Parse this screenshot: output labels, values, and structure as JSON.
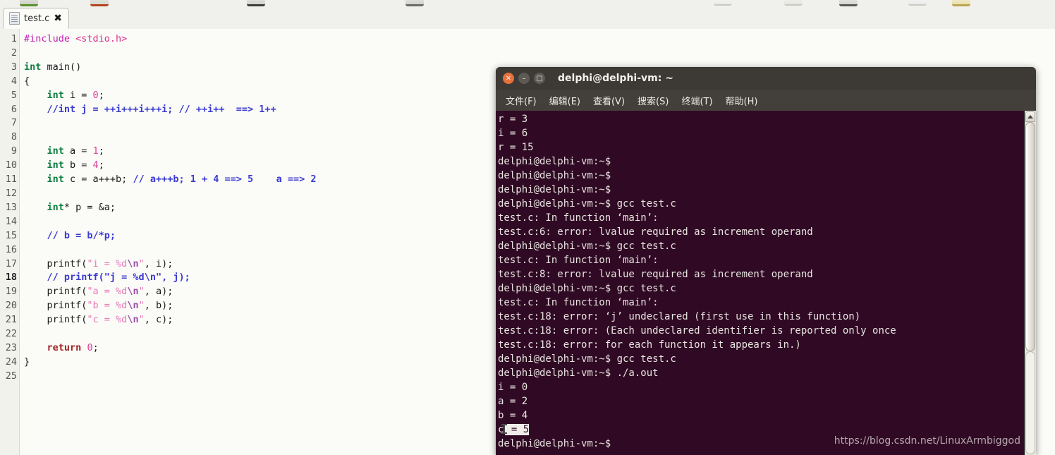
{
  "editor": {
    "tab": {
      "label": "test.c",
      "close_label": "✖",
      "icon": "document-icon"
    },
    "lines": [
      {
        "n": "1",
        "tokens": [
          {
            "t": "#include ",
            "c": "pp"
          },
          {
            "t": "<stdio.h>",
            "c": "hd"
          }
        ]
      },
      {
        "n": "2",
        "tokens": []
      },
      {
        "n": "3",
        "tokens": [
          {
            "t": "int",
            "c": "k"
          },
          {
            "t": " main()",
            "c": ""
          }
        ]
      },
      {
        "n": "4",
        "tokens": [
          {
            "t": "{",
            "c": ""
          }
        ]
      },
      {
        "n": "5",
        "tokens": [
          {
            "t": "    ",
            "c": ""
          },
          {
            "t": "int",
            "c": "k"
          },
          {
            "t": " i = ",
            "c": ""
          },
          {
            "t": "0",
            "c": "nm"
          },
          {
            "t": ";",
            "c": ""
          }
        ]
      },
      {
        "n": "6",
        "tokens": [
          {
            "t": "    ",
            "c": ""
          },
          {
            "t": "//int j = ++i+++i+++i; // ++i++  ==> 1++",
            "c": "cm"
          }
        ]
      },
      {
        "n": "7",
        "tokens": []
      },
      {
        "n": "8",
        "tokens": []
      },
      {
        "n": "9",
        "tokens": [
          {
            "t": "    ",
            "c": ""
          },
          {
            "t": "int",
            "c": "k"
          },
          {
            "t": " a = ",
            "c": ""
          },
          {
            "t": "1",
            "c": "nm"
          },
          {
            "t": ";",
            "c": ""
          }
        ]
      },
      {
        "n": "10",
        "tokens": [
          {
            "t": "    ",
            "c": ""
          },
          {
            "t": "int",
            "c": "k"
          },
          {
            "t": " b = ",
            "c": ""
          },
          {
            "t": "4",
            "c": "nm"
          },
          {
            "t": ";",
            "c": ""
          }
        ]
      },
      {
        "n": "11",
        "tokens": [
          {
            "t": "    ",
            "c": ""
          },
          {
            "t": "int",
            "c": "k"
          },
          {
            "t": " c = a+++b; ",
            "c": ""
          },
          {
            "t": "// a+++b; 1 + 4 ==> 5    a ==> 2",
            "c": "cm"
          }
        ]
      },
      {
        "n": "12",
        "tokens": []
      },
      {
        "n": "13",
        "tokens": [
          {
            "t": "    ",
            "c": ""
          },
          {
            "t": "int",
            "c": "k"
          },
          {
            "t": "* p = &a;",
            "c": ""
          }
        ]
      },
      {
        "n": "14",
        "tokens": []
      },
      {
        "n": "15",
        "tokens": [
          {
            "t": "    ",
            "c": ""
          },
          {
            "t": "// b = b/*p;",
            "c": "cm"
          }
        ]
      },
      {
        "n": "16",
        "tokens": []
      },
      {
        "n": "17",
        "tokens": [
          {
            "t": "    printf(",
            "c": ""
          },
          {
            "t": "\"i = %d",
            "c": "st"
          },
          {
            "t": "\\n",
            "c": "es"
          },
          {
            "t": "\"",
            "c": "st"
          },
          {
            "t": ", i);",
            "c": ""
          }
        ]
      },
      {
        "n": "18",
        "tokens": [
          {
            "t": "    ",
            "c": ""
          },
          {
            "t": "// printf(\"j = %d\\n\", j);",
            "c": "cm"
          }
        ],
        "current": true
      },
      {
        "n": "19",
        "tokens": [
          {
            "t": "    printf(",
            "c": ""
          },
          {
            "t": "\"a = %d",
            "c": "st"
          },
          {
            "t": "\\n",
            "c": "es"
          },
          {
            "t": "\"",
            "c": "st"
          },
          {
            "t": ", a);",
            "c": ""
          }
        ]
      },
      {
        "n": "20",
        "tokens": [
          {
            "t": "    printf(",
            "c": ""
          },
          {
            "t": "\"b = %d",
            "c": "st"
          },
          {
            "t": "\\n",
            "c": "es"
          },
          {
            "t": "\"",
            "c": "st"
          },
          {
            "t": ", b);",
            "c": ""
          }
        ]
      },
      {
        "n": "21",
        "tokens": [
          {
            "t": "    printf(",
            "c": ""
          },
          {
            "t": "\"c = %d",
            "c": "st"
          },
          {
            "t": "\\n",
            "c": "es"
          },
          {
            "t": "\"",
            "c": "st"
          },
          {
            "t": ", c);",
            "c": ""
          }
        ]
      },
      {
        "n": "22",
        "tokens": []
      },
      {
        "n": "23",
        "tokens": [
          {
            "t": "    ",
            "c": ""
          },
          {
            "t": "return",
            "c": "rt"
          },
          {
            "t": " ",
            "c": ""
          },
          {
            "t": "0",
            "c": "nm"
          },
          {
            "t": ";",
            "c": ""
          }
        ]
      },
      {
        "n": "24",
        "tokens": [
          {
            "t": "}",
            "c": ""
          }
        ]
      },
      {
        "n": "25",
        "tokens": []
      }
    ]
  },
  "terminal": {
    "title": "delphi@delphi-vm: ~",
    "window_buttons": {
      "close": "✕",
      "minimize": "–",
      "maximize": "▢"
    },
    "menu": [
      {
        "label": "文件(F)"
      },
      {
        "label": "编辑(E)"
      },
      {
        "label": "查看(V)"
      },
      {
        "label": "搜索(S)"
      },
      {
        "label": "终端(T)"
      },
      {
        "label": "帮助(H)"
      }
    ],
    "lines": [
      {
        "text": "r = 3"
      },
      {
        "text": "i = 6"
      },
      {
        "text": "r = 15"
      },
      {
        "text": "delphi@delphi-vm:~$"
      },
      {
        "text": "delphi@delphi-vm:~$"
      },
      {
        "text": "delphi@delphi-vm:~$"
      },
      {
        "text": "delphi@delphi-vm:~$ gcc test.c"
      },
      {
        "text": "test.c: In function ‘main’:"
      },
      {
        "text": "test.c:6: error: lvalue required as increment operand"
      },
      {
        "text": "delphi@delphi-vm:~$ gcc test.c"
      },
      {
        "text": "test.c: In function ‘main’:"
      },
      {
        "text": "test.c:8: error: lvalue required as increment operand"
      },
      {
        "text": "delphi@delphi-vm:~$ gcc test.c"
      },
      {
        "text": "test.c: In function ‘main’:"
      },
      {
        "text": "test.c:18: error: ‘j’ undeclared (first use in this function)"
      },
      {
        "text": "test.c:18: error: (Each undeclared identifier is reported only once"
      },
      {
        "text": "test.c:18: error: for each function it appears in.)"
      },
      {
        "text": "delphi@delphi-vm:~$ gcc test.c"
      },
      {
        "text": "delphi@delphi-vm:~$ ./a.out"
      },
      {
        "text": "i = 0"
      },
      {
        "text": "a = 2"
      },
      {
        "text": "b = 4"
      },
      {
        "text": "c",
        "selected": " = 5",
        "cursor": true
      },
      {
        "text": "delphi@delphi-vm:~$"
      }
    ],
    "scrollbar": {
      "up_arrow": "▲"
    }
  },
  "watermark": {
    "text": "https://blog.csdn.net/LinuxArmbiggod"
  },
  "colors": {
    "terminal_bg": "#300a24",
    "terminal_titlebar": "#3d3a36",
    "terminal_menubar": "#43403b",
    "close_button": "#e8713a",
    "editor_bg": "#fbfbf8",
    "gutter_bg": "#f2f2ec",
    "keyword": "#0d7f3f",
    "comment": "#3b3bd0",
    "string": "#e878b8",
    "number": "#e0409a",
    "preprocessor": "#c020b0"
  }
}
